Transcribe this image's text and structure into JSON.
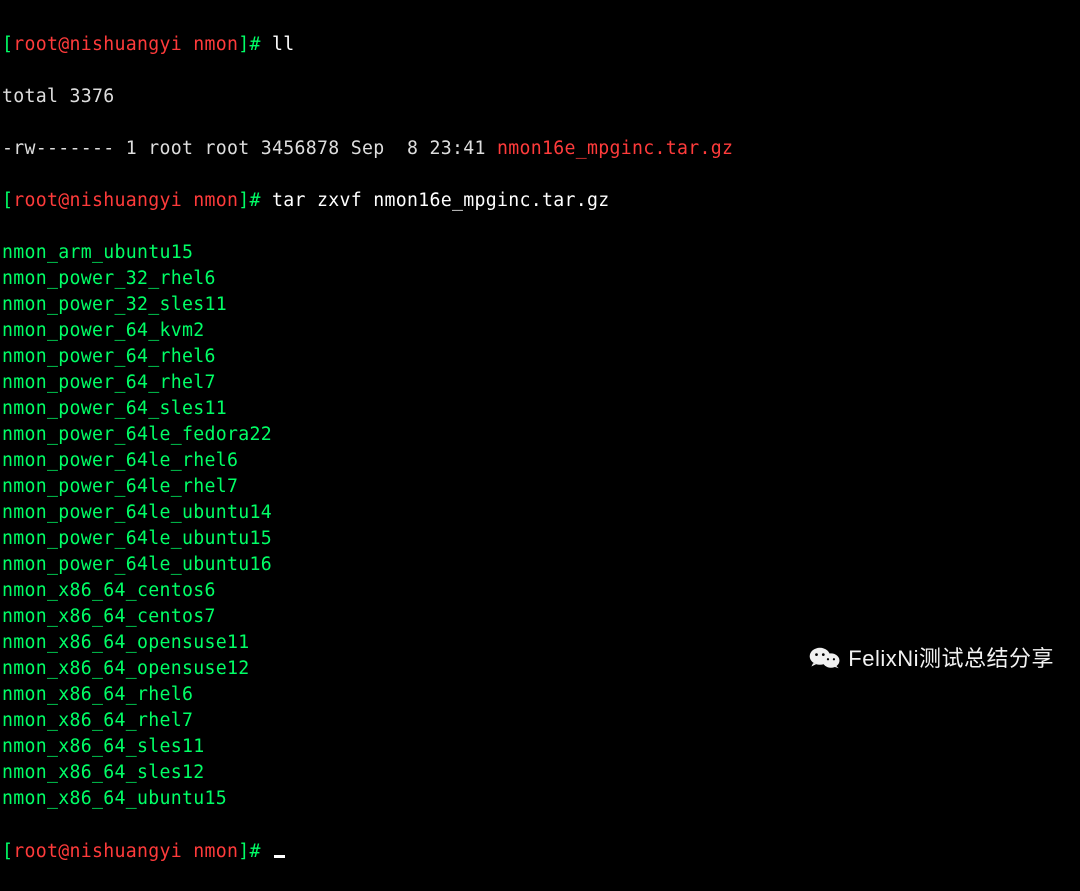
{
  "prompt": {
    "open": "[",
    "user_host": "root@nishuangyi",
    "dir": "nmon",
    "close": "]",
    "symbol": "#"
  },
  "line1": {
    "command": "ll"
  },
  "line2": {
    "total": "total 3376"
  },
  "line3": {
    "perms_etc": "-rw------- 1 root root 3456878 Sep  8 23:41 ",
    "filename": "nmon16e_mpginc.tar.gz"
  },
  "line4": {
    "command": "tar zxvf nmon16e_mpginc.tar.gz"
  },
  "extracted": [
    "nmon_arm_ubuntu15",
    "nmon_power_32_rhel6",
    "nmon_power_32_sles11",
    "nmon_power_64_kvm2",
    "nmon_power_64_rhel6",
    "nmon_power_64_rhel7",
    "nmon_power_64_sles11",
    "nmon_power_64le_fedora22",
    "nmon_power_64le_rhel6",
    "nmon_power_64le_rhel7",
    "nmon_power_64le_ubuntu14",
    "nmon_power_64le_ubuntu15",
    "nmon_power_64le_ubuntu16",
    "nmon_x86_64_centos6",
    "nmon_x86_64_centos7",
    "nmon_x86_64_opensuse11",
    "nmon_x86_64_opensuse12",
    "nmon_x86_64_rhel6",
    "nmon_x86_64_rhel7",
    "nmon_x86_64_sles11",
    "nmon_x86_64_sles12",
    "nmon_x86_64_ubuntu15"
  ],
  "watermark": {
    "text": "FelixNi测试总结分享"
  }
}
